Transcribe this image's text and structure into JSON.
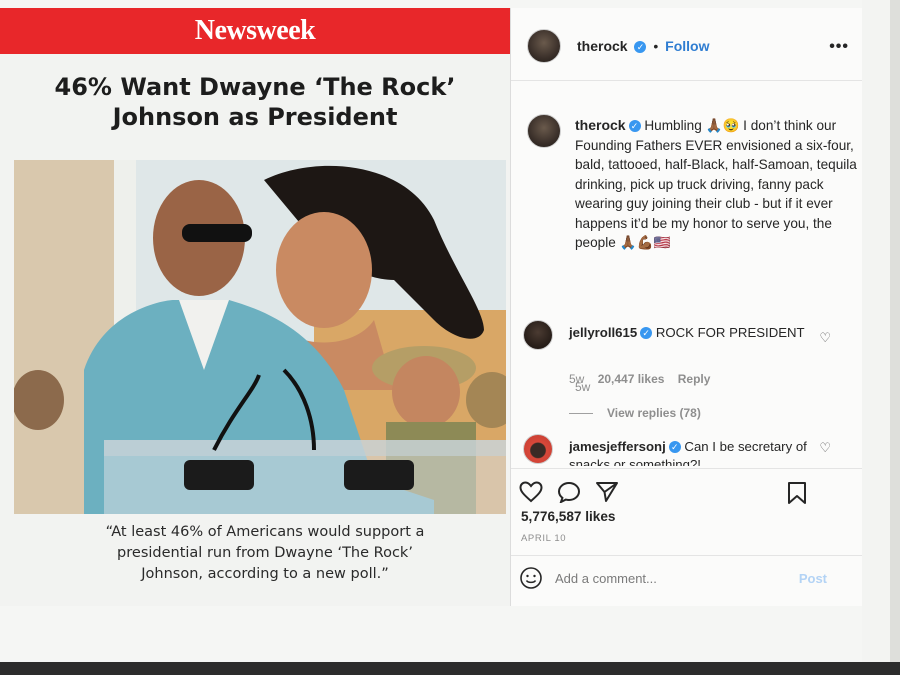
{
  "article": {
    "publication": "Newsweek",
    "headline_line1": "46% Want Dwayne ‘The Rock’",
    "headline_line2": "Johnson as President",
    "caption_line1": "“At least 46% of Americans would support a",
    "caption_line2": "presidential run from Dwayne ‘The Rock’",
    "caption_line3": "Johnson, according to a new poll.”",
    "brand_color": "#e8272a"
  },
  "post_header": {
    "username": "therock",
    "separator": "•",
    "follow_label": "Follow",
    "more_icon": "•••"
  },
  "caption": {
    "username": "therock",
    "text": "Humbling 🙏🏾🥹 I don’t think our Founding Fathers EVER envisioned a six-four, bald, tattooed, half-Black, half-Samoan, tequila drinking, pick up truck driving, fanny pack wearing guy joining their club - but if it ever happens it’d be my honor to serve you, the people 🙏🏾💪🏾🇺🇸",
    "time": "5w"
  },
  "comments": [
    {
      "username": "jellyroll615",
      "text": "ROCK FOR PRESIDENT",
      "time": "5w",
      "likes": "20,447 likes",
      "reply_label": "Reply",
      "view_replies": "View replies (78)"
    },
    {
      "username": "jamesjeffersonj",
      "text": "Can I be secretary of snacks or something?!"
    }
  ],
  "actions": {
    "likes": "5,776,587 likes",
    "date": "APRIL 10",
    "comment_placeholder": "Add a comment...",
    "post_label": "Post",
    "accent": "#3897f0"
  }
}
